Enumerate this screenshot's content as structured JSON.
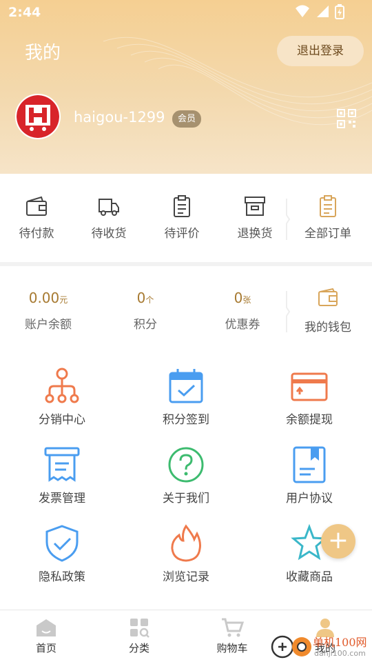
{
  "status_bar": {
    "time": "2:44"
  },
  "header": {
    "title": "我的",
    "logout_label": "退出登录",
    "username": "haigou-1299",
    "member_badge": "会员"
  },
  "orders": [
    {
      "label": "待付款",
      "icon": "wallet-icon"
    },
    {
      "label": "待收货",
      "icon": "truck-icon"
    },
    {
      "label": "待评价",
      "icon": "clipboard-icon"
    },
    {
      "label": "退换货",
      "icon": "archive-box-icon"
    },
    {
      "label": "全部订单",
      "icon": "order-list-icon"
    }
  ],
  "wallet": {
    "balance": {
      "value": "0.00",
      "unit": "元",
      "label": "账户余额"
    },
    "points": {
      "value": "0",
      "unit": "个",
      "label": "积分"
    },
    "coupons": {
      "value": "0",
      "unit": "张",
      "label": "优惠券"
    },
    "my_wallet_label": "我的钱包"
  },
  "grid": [
    {
      "label": "分销中心",
      "icon": "distribution-icon",
      "color": "#ef7a4c"
    },
    {
      "label": "积分签到",
      "icon": "calendar-check-icon",
      "color": "#4a9df0"
    },
    {
      "label": "余额提现",
      "icon": "card-withdraw-icon",
      "color": "#ef7a4c"
    },
    {
      "label": "发票管理",
      "icon": "receipt-icon",
      "color": "#4a9df0"
    },
    {
      "label": "关于我们",
      "icon": "question-circle-icon",
      "color": "#3dbb6f"
    },
    {
      "label": "用户协议",
      "icon": "document-icon",
      "color": "#4a9df0"
    },
    {
      "label": "隐私政策",
      "icon": "shield-check-icon",
      "color": "#4a9df0"
    },
    {
      "label": "浏览记录",
      "icon": "flame-icon",
      "color": "#ef7a4c"
    },
    {
      "label": "收藏商品",
      "icon": "star-icon",
      "color": "#3ab7c9"
    }
  ],
  "fab_label": "+",
  "bottom_nav": [
    {
      "label": "首页",
      "icon": "home-icon"
    },
    {
      "label": "分类",
      "icon": "category-icon"
    },
    {
      "label": "购物车",
      "icon": "cart-icon"
    },
    {
      "label": "我的",
      "icon": "user-icon"
    }
  ],
  "watermark": {
    "text": "单机100网",
    "url": "danji100.com"
  },
  "colors": {
    "accent": "#a77a31",
    "header": "#f5cf92",
    "fab": "#efc786"
  }
}
